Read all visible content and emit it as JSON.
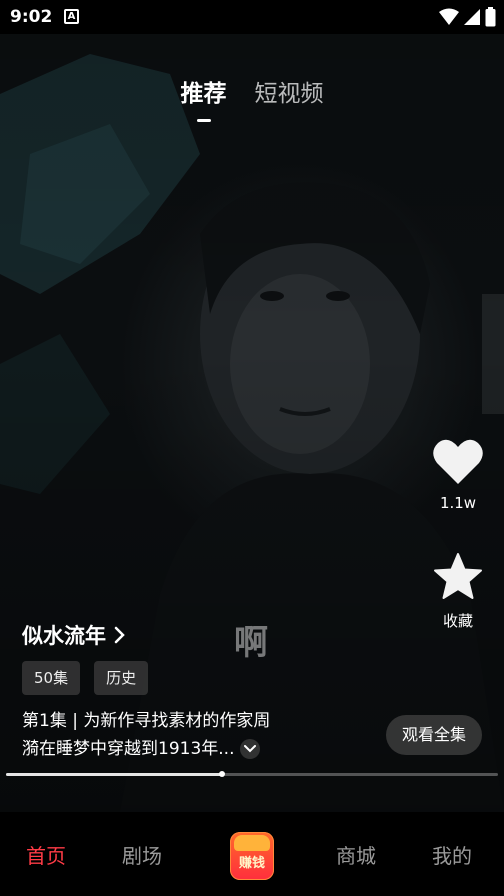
{
  "status_bar": {
    "time": "9:02",
    "a_icon": "A"
  },
  "top_tabs": [
    {
      "label": "推荐",
      "active": true
    },
    {
      "label": "短视频",
      "active": false
    }
  ],
  "actions": {
    "like_count": "1.1w",
    "favorite_label": "收藏"
  },
  "watermark": "啊",
  "drama": {
    "title": "似水流年",
    "tags": [
      "50集",
      "历史"
    ],
    "description_line1": "第1集 | 为新作寻找素材的作家周",
    "description_line2": "漪在睡梦中穿越到1913年...",
    "watch_all_label": "观看全集"
  },
  "playback": {
    "progress": 0.44
  },
  "bottom_nav": {
    "home": "首页",
    "theater": "剧场",
    "earn": "赚钱",
    "mall": "商城",
    "mine": "我的"
  },
  "colors": {
    "accent": "#ff3b46",
    "nav_inactive": "#9a9a9a"
  },
  "icons": [
    "wifi-icon",
    "signal-icon",
    "battery-icon",
    "heart-icon",
    "star-icon",
    "chevron-right-icon",
    "chevron-down-icon",
    "red-envelope-icon"
  ]
}
